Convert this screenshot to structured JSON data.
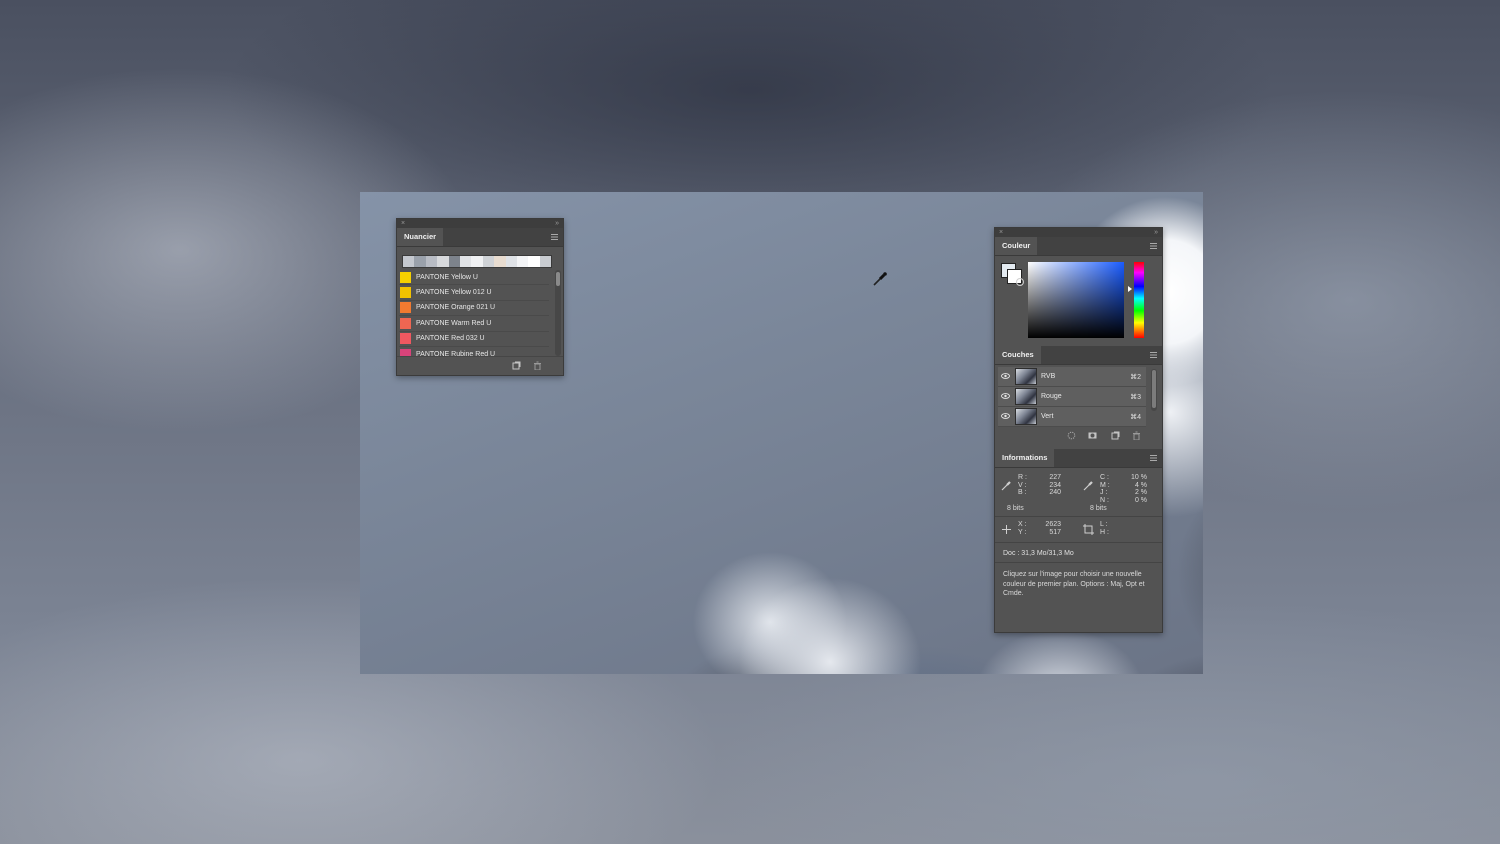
{
  "swatches_panel": {
    "tab": "Nuancier",
    "recent_colors": [
      "#c4c8cf",
      "#9aa1ab",
      "#b8bcc4",
      "#d7d9dc",
      "#7d838c",
      "#e1e3e6",
      "#f0f1f3",
      "#cfd2d6",
      "#e8dcd0",
      "#dfe2e6",
      "#f3f4f6",
      "#ffffff",
      "#c9ccd1"
    ],
    "items": [
      {
        "name": "PANTONE Yellow U",
        "color": "#f5d000"
      },
      {
        "name": "PANTONE Yellow 012 U",
        "color": "#f2c200"
      },
      {
        "name": "PANTONE Orange 021 U",
        "color": "#f27a30"
      },
      {
        "name": "PANTONE Warm Red U",
        "color": "#ef6652"
      },
      {
        "name": "PANTONE Red 032 U",
        "color": "#ef5860"
      },
      {
        "name": "PANTONE Rubine Red U",
        "color": "#d9437a"
      }
    ]
  },
  "color_panel": {
    "tab": "Couleur",
    "foreground": "#e3eaf0",
    "background": "#ffffff"
  },
  "channels_panel": {
    "tab": "Couches",
    "channels": [
      {
        "name": "RVB",
        "shortcut": "⌘2"
      },
      {
        "name": "Rouge",
        "shortcut": "⌘3"
      },
      {
        "name": "Vert",
        "shortcut": "⌘4"
      }
    ]
  },
  "info_panel": {
    "tab": "Informations",
    "rgb_labels": "R :\nV :\nB :",
    "rgb_values": "227\n234\n240",
    "cmyk_labels": "C :\nM :\nJ :\nN :",
    "cmyk_values": "10 %\n4 %\n2 %\n0 %",
    "bits_left": "8 bits",
    "bits_right": "8 bits",
    "xy_labels": "X :\nY :",
    "xy_values": "2623\n517",
    "lh_labels": "L :\nH :",
    "doc_size": "Doc : 31,3 Mo/31,3 Mo",
    "hint": "Cliquez sur l'image pour choisir une nouvelle couleur de premier plan. Options : Maj, Opt et Cmde."
  }
}
